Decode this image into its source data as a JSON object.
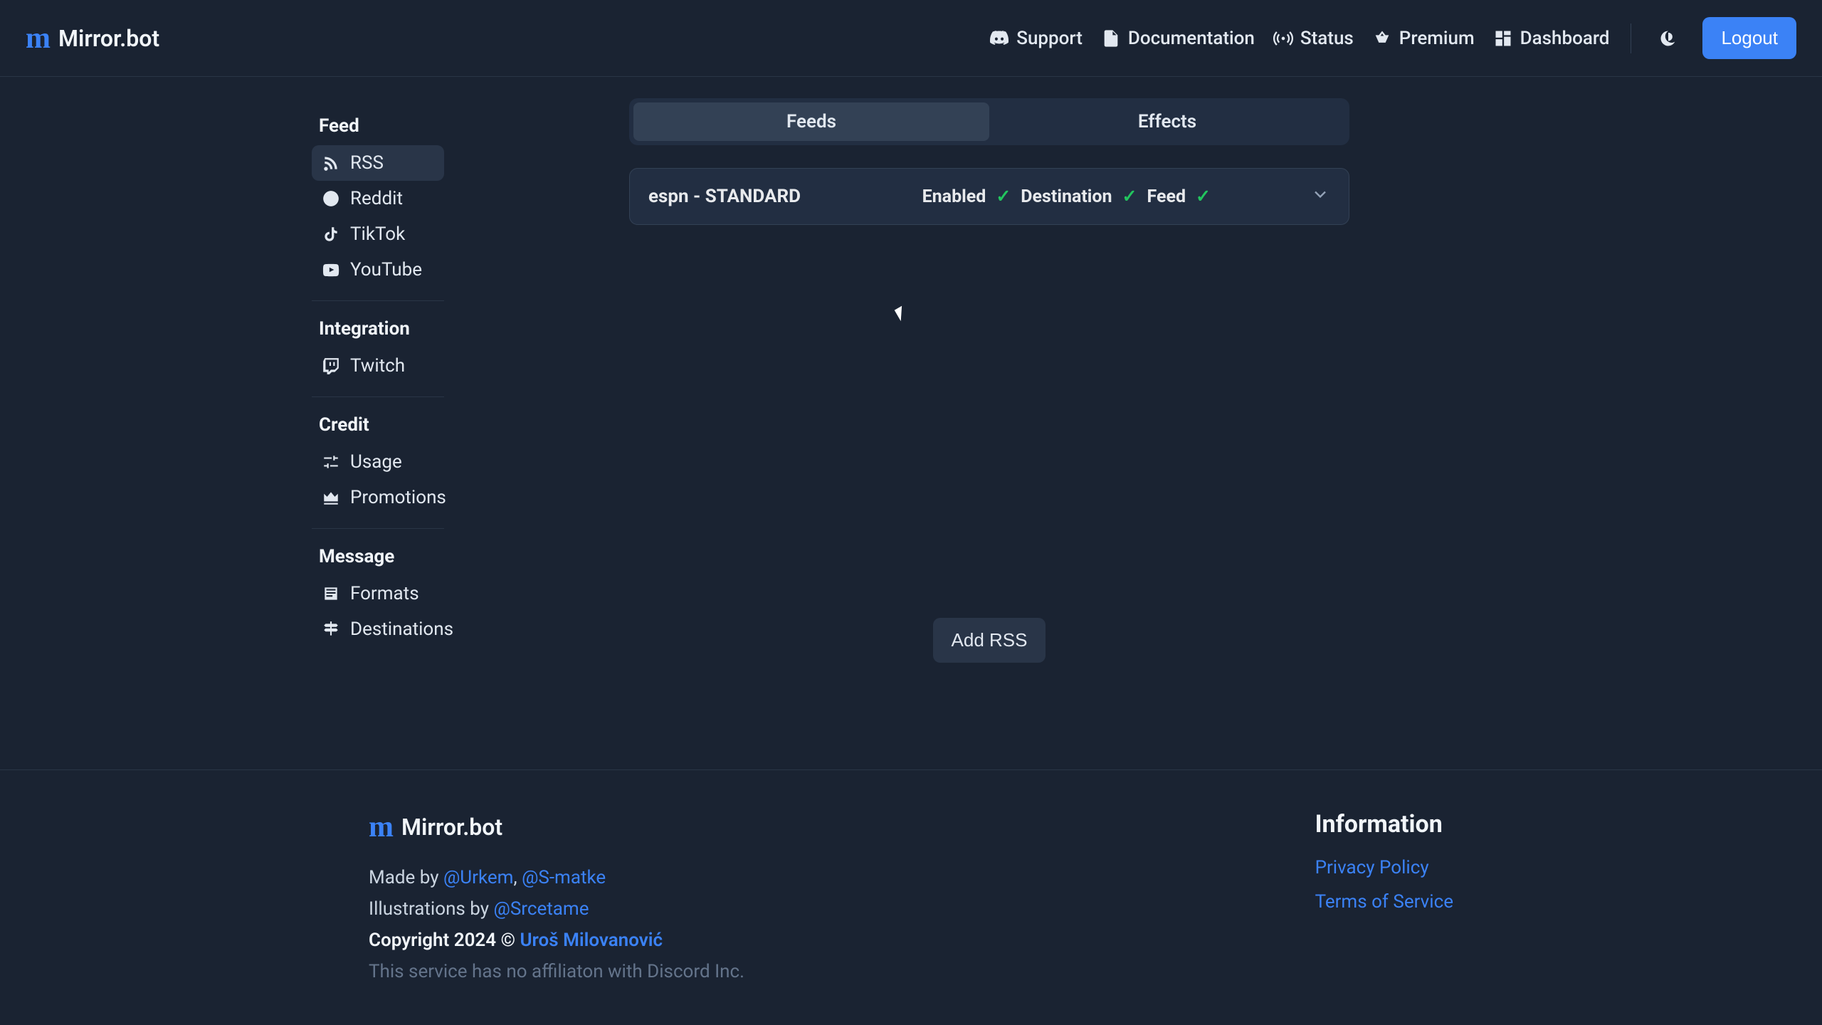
{
  "brand": {
    "name": "Mirror.bot"
  },
  "header": {
    "support": "Support",
    "documentation": "Documentation",
    "status": "Status",
    "premium": "Premium",
    "dashboard": "Dashboard",
    "logout": "Logout"
  },
  "sidebar": {
    "feed": {
      "heading": "Feed",
      "items": [
        {
          "label": "RSS"
        },
        {
          "label": "Reddit"
        },
        {
          "label": "TikTok"
        },
        {
          "label": "YouTube"
        }
      ]
    },
    "integration": {
      "heading": "Integration",
      "items": [
        {
          "label": "Twitch"
        }
      ]
    },
    "credit": {
      "heading": "Credit",
      "items": [
        {
          "label": "Usage"
        },
        {
          "label": "Promotions"
        }
      ]
    },
    "message": {
      "heading": "Message",
      "items": [
        {
          "label": "Formats"
        },
        {
          "label": "Destinations"
        }
      ]
    }
  },
  "content": {
    "tabs": {
      "feeds": "Feeds",
      "effects": "Effects"
    },
    "feedRow": {
      "name": "espn - STANDARD",
      "enabled_label": "Enabled",
      "destination_label": "Destination",
      "feed_label": "Feed",
      "check": "✓"
    },
    "add_button": "Add RSS"
  },
  "footer": {
    "made_by_prefix": "Made by ",
    "author1": "@Urkem",
    "author_sep": ", ",
    "author2": "@S-matke",
    "illus_prefix": "Illustrations by ",
    "illustrator": "@Srcetame",
    "copyright_prefix": "Copyright 2024 © ",
    "copyright_name": "Uroš Milovanović",
    "disclaimer": "This service has no affiliaton with Discord Inc.",
    "info_heading": "Information",
    "privacy": "Privacy Policy",
    "tos": "Terms of Service"
  }
}
